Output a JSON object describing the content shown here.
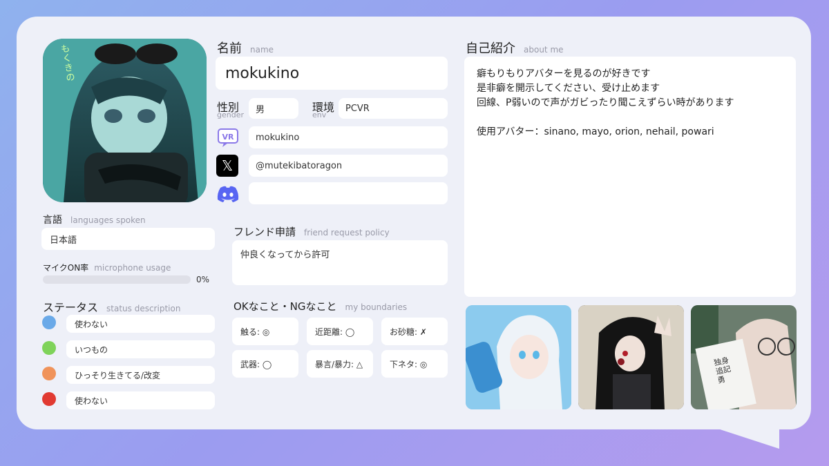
{
  "profile": {
    "name_label": "名前",
    "name_sub": "name",
    "name": "mokukino",
    "gender_label": "性別",
    "gender_sub": "gender",
    "gender": "男",
    "env_label": "環境",
    "env_sub": "env",
    "env": "PCVR",
    "vrchat": "mokukino",
    "x_handle": "@mutekibatoragon",
    "discord": "",
    "avatar_tag": "もくきの"
  },
  "languages": {
    "label": "言語",
    "sub": "languages spoken",
    "value": "日本語"
  },
  "mic": {
    "label": "マイクON率",
    "sub": "microphone usage",
    "percent_text": "0%",
    "percent": 0
  },
  "status": {
    "label": "ステータス",
    "sub": "status description",
    "items": [
      {
        "color": "#6aa9e8",
        "text": "使わない"
      },
      {
        "color": "#7fd35a",
        "text": "いつもの"
      },
      {
        "color": "#f0935a",
        "text": "ひっそり生きてる/改変"
      },
      {
        "color": "#e13a32",
        "text": "使わない"
      }
    ]
  },
  "friend": {
    "label": "フレンド申請",
    "sub": "friend request policy",
    "value": "仲良くなってから許可"
  },
  "boundaries": {
    "label": "OKなこと・NGなこと",
    "sub": "my boundaries",
    "items": [
      "触る: ◎",
      "近距離: ◯",
      "お砂糖: ✗",
      "武器: ◯",
      "暴言/暴力: △",
      "下ネタ: ◎"
    ]
  },
  "about": {
    "label": "自己紹介",
    "sub": "about me",
    "lines": [
      "癖もりもりアバターを見るのが好きです",
      "是非癖を開示してください、受け止めます",
      "回線、P弱いので声がガビったり聞こえずらい時があります",
      "",
      "使用アバター：sinano, mayo, orion, nehail, powari"
    ]
  },
  "thumb3_text": "独身\n追記\n勇"
}
